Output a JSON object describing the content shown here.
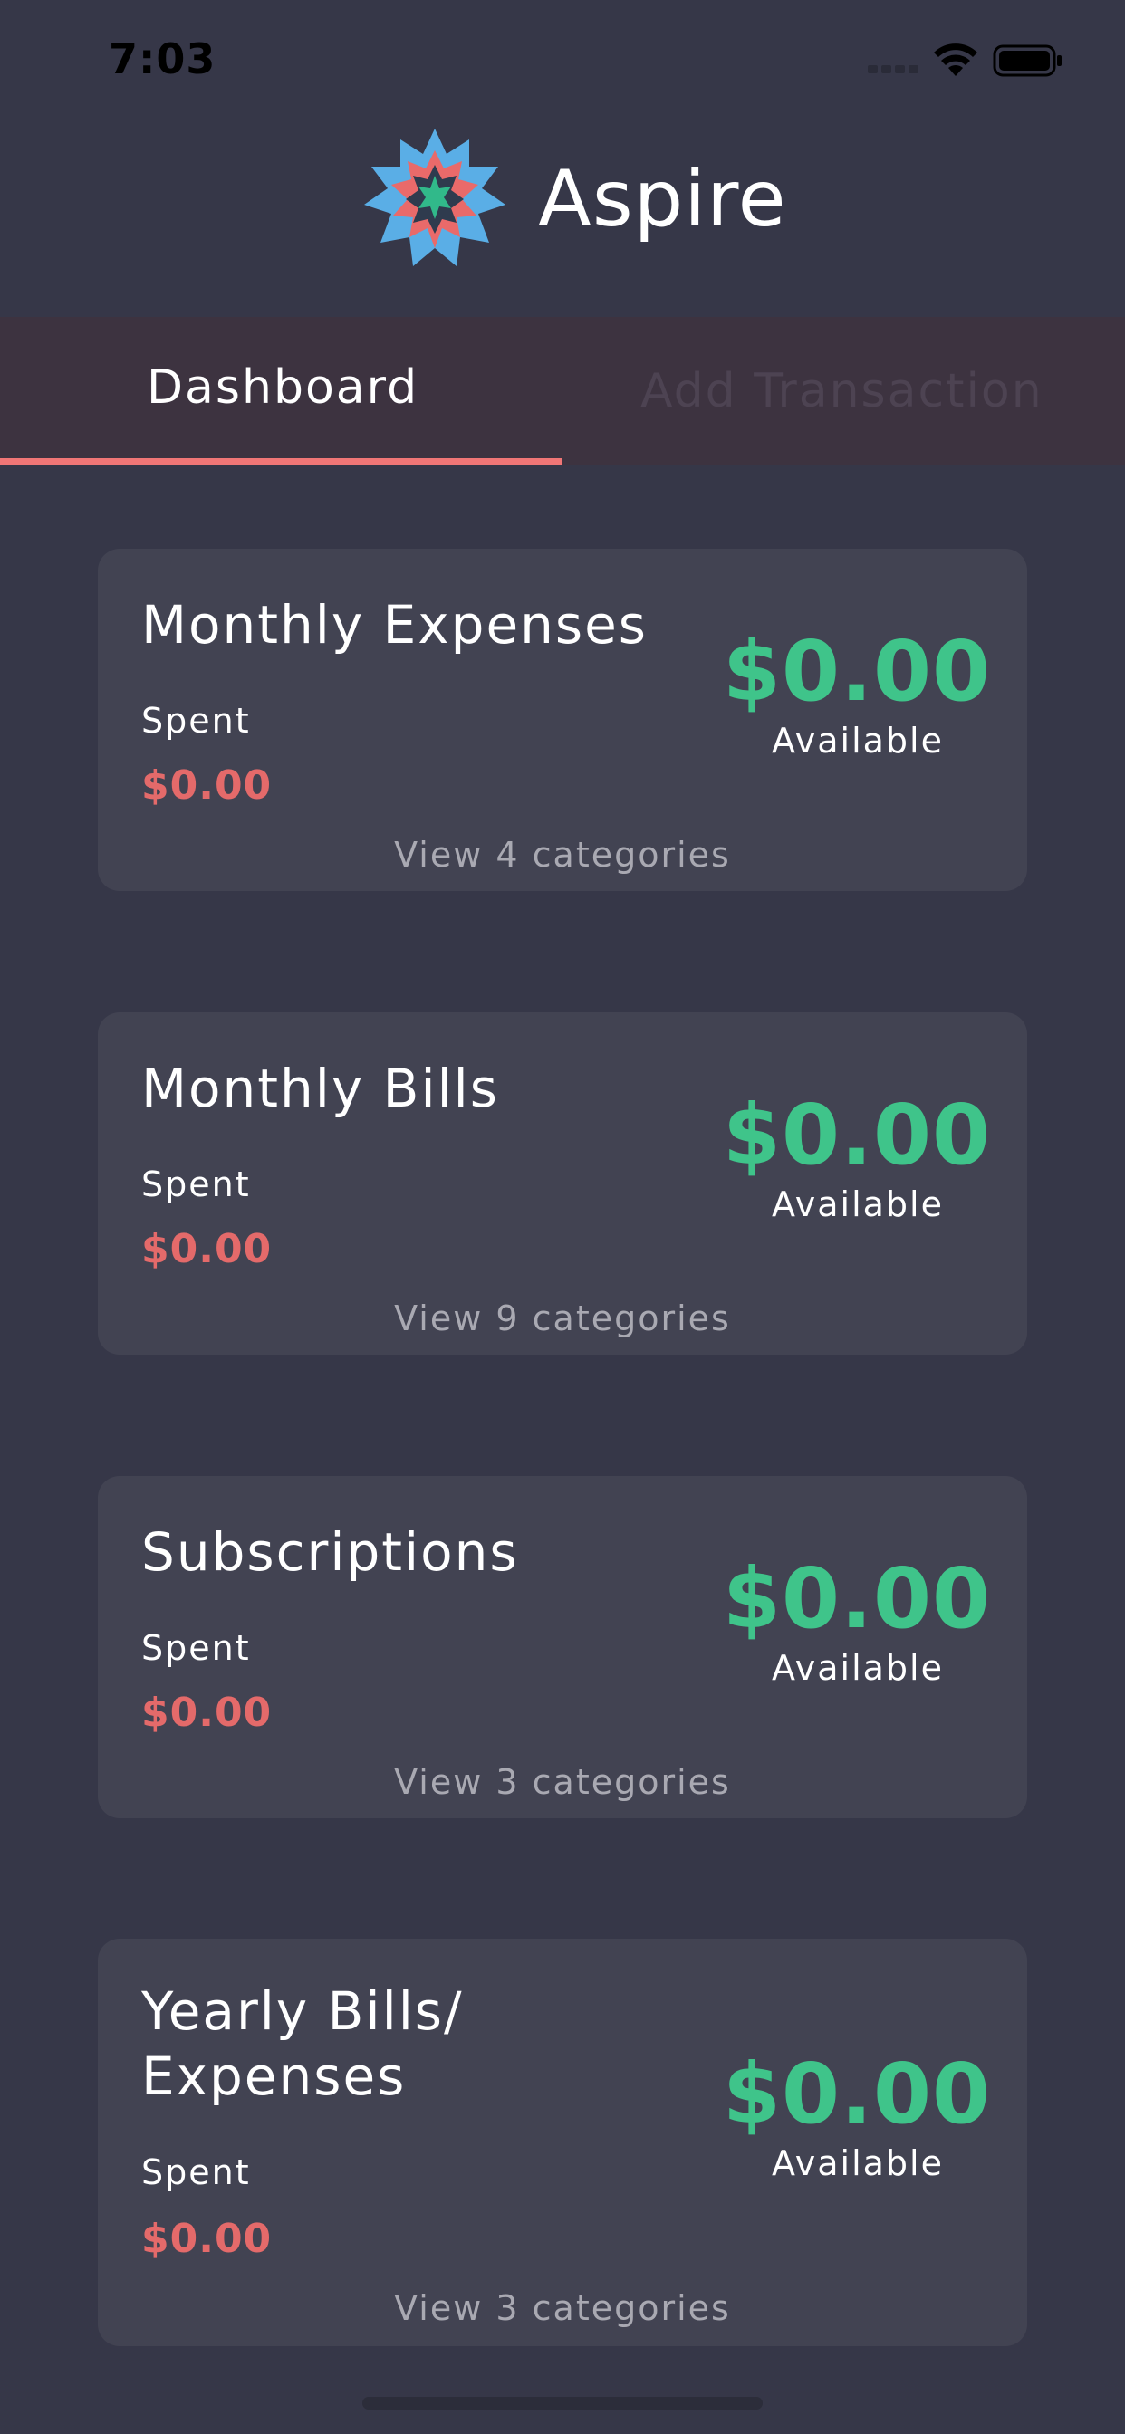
{
  "status_bar": {
    "time": "7:03"
  },
  "header": {
    "title": "Aspire",
    "logo_icon": "aspire-star-logo"
  },
  "tabs": [
    {
      "label": "Dashboard",
      "active": true
    },
    {
      "label": "Add Transaction",
      "active": false
    }
  ],
  "colors": {
    "background": "#363748",
    "card": "#424352",
    "accent": "#f07676",
    "spent": "#e46a6a",
    "available": "#3fc48a"
  },
  "cards": [
    {
      "title": "Monthly Expenses",
      "spent_label": "Spent",
      "spent": "$0.00",
      "available": "$0.00",
      "available_label": "Available",
      "link": "View 4 categories"
    },
    {
      "title": "Monthly Bills",
      "spent_label": "Spent",
      "spent": "$0.00",
      "available": "$0.00",
      "available_label": "Available",
      "link": "View 9 categories"
    },
    {
      "title": "Subscriptions",
      "spent_label": "Spent",
      "spent": "$0.00",
      "available": "$0.00",
      "available_label": "Available",
      "link": "View 3 categories"
    },
    {
      "title_line1": "Yearly Bills/",
      "title_line2": "Expenses",
      "spent_label": "Spent",
      "spent": "$0.00",
      "available": "$0.00",
      "available_label": "Available",
      "link": "View 3 categories"
    }
  ]
}
